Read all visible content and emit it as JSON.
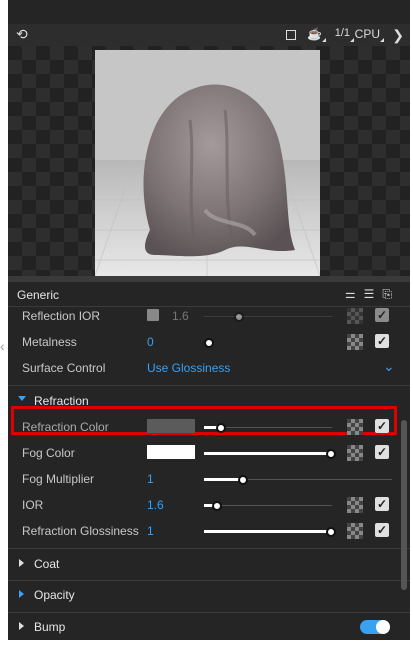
{
  "window": {
    "controls": [
      "—",
      "☐",
      "✕"
    ]
  },
  "toolbar": {
    "ratio": "1/1",
    "cpu": "CPU",
    "close": "❯"
  },
  "panel": {
    "title": "Generic"
  },
  "rows": {
    "reflection_ior": {
      "label": "Reflection IOR",
      "value": "1.6"
    },
    "metalness": {
      "label": "Metalness",
      "value": "0"
    },
    "surface_control": {
      "label": "Surface Control",
      "value": "Use Glossiness"
    },
    "refraction_color": {
      "label": "Refraction Color",
      "color": "#5b5b5b",
      "level": 0.12
    },
    "fog_color": {
      "label": "Fog Color",
      "color": "#ffffff",
      "level": 1.0
    },
    "fog_multiplier": {
      "label": "Fog Multiplier",
      "value": "1",
      "level": 0.2
    },
    "ior": {
      "label": "IOR",
      "value": "1.6"
    },
    "refraction_glossiness": {
      "label": "Refraction Glossiness",
      "value": "1",
      "level": 1.0
    }
  },
  "sections": {
    "refraction": "Refraction",
    "coat": "Coat",
    "opacity": "Opacity",
    "bump": "Bump"
  },
  "checkmark": "✓",
  "colors": {
    "accent": "#3aa0f0",
    "highlight": "#e00000",
    "panel_bg": "#252526"
  }
}
